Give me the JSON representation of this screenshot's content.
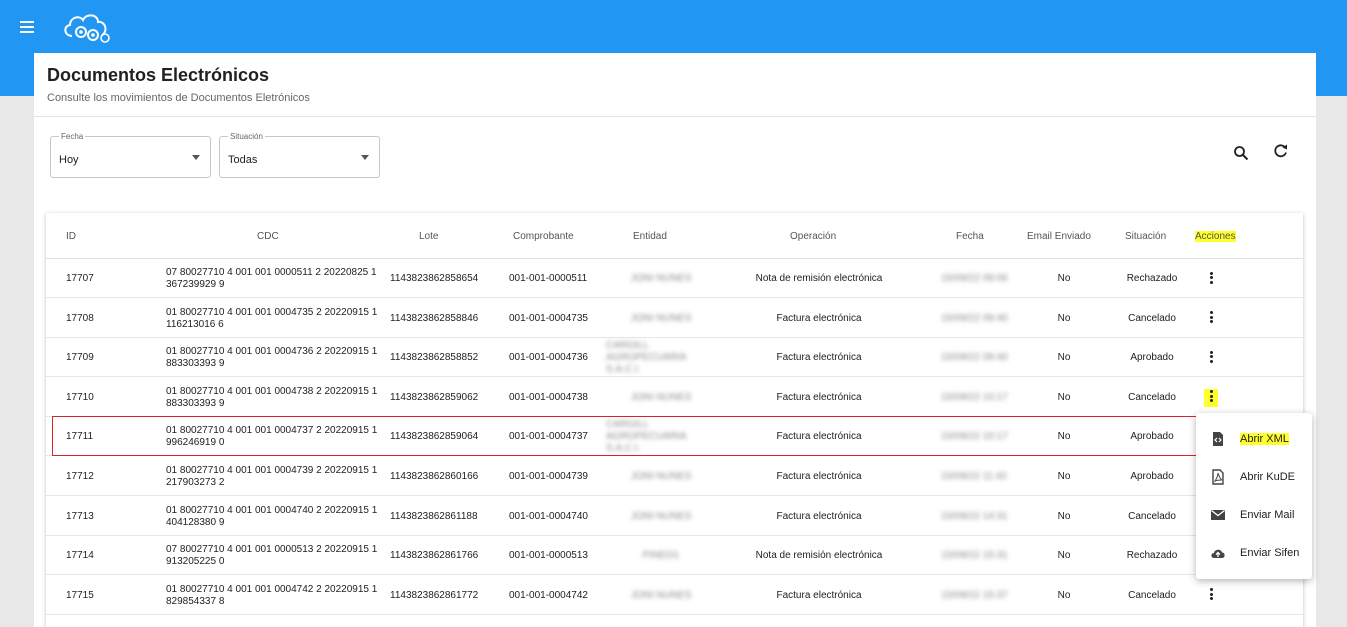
{
  "app": {
    "logo": "cloud-gears-logo"
  },
  "page": {
    "title": "Documentos Electrónicos",
    "subtitle": "Consulte los movimientos de Documentos Eletrónicos"
  },
  "filters": {
    "fecha": {
      "label": "Fecha",
      "value": "Hoy"
    },
    "situacion": {
      "label": "Situación",
      "value": "Todas"
    }
  },
  "table": {
    "headers": {
      "id": "ID",
      "cdc": "CDC",
      "lote": "Lote",
      "comprobante": "Comprobante",
      "entidad": "Entidad",
      "operacion": "Operación",
      "fecha": "Fecha",
      "email": "Email Enviado",
      "situacion": "Situación",
      "acciones": "Acciones"
    },
    "rows": [
      {
        "id": "17707",
        "cdc1": "07 80027710 4 001 001 0000511 2 20220825 1",
        "cdc2": "367239929 9",
        "lote": "1143823862858654",
        "comprobante": "001-001-0000511",
        "entidad": "JONI NUNES",
        "operacion": "Nota de remisión electrónica",
        "fecha": "15/09/22 09:06",
        "email": "No",
        "situacion": "Rechazado"
      },
      {
        "id": "17708",
        "cdc1": "01 80027710 4 001 001 0004735 2 20220915 1",
        "cdc2": "116213016 6",
        "lote": "1143823862858846",
        "comprobante": "001-001-0004735",
        "entidad": "JONI NUNES",
        "operacion": "Factura electrónica",
        "fecha": "15/09/22 09:40",
        "email": "No",
        "situacion": "Cancelado"
      },
      {
        "id": "17709",
        "cdc1": "01 80027710 4 001 001 0004736 2 20220915 1",
        "cdc2": "883303393 9",
        "lote": "1143823862858852",
        "comprobante": "001-001-0004736",
        "entidad": "CARGILL AGROPECUARIA S.A.C.I.",
        "operacion": "Factura electrónica",
        "fecha": "15/09/22 09:40",
        "email": "No",
        "situacion": "Aprobado"
      },
      {
        "id": "17710",
        "cdc1": "01 80027710 4 001 001 0004738 2 20220915 1",
        "cdc2": "883303393 9",
        "lote": "1143823862859062",
        "comprobante": "001-001-0004738",
        "entidad": "JONI NUNES",
        "operacion": "Factura electrónica",
        "fecha": "15/09/22 10:17",
        "email": "No",
        "situacion": "Cancelado"
      },
      {
        "id": "17711",
        "cdc1": "01 80027710 4 001 001 0004737 2 20220915 1",
        "cdc2": "996246919 0",
        "lote": "1143823862859064",
        "comprobante": "001-001-0004737",
        "entidad": "CARGILL AGROPECUARIA S.A.C.I.",
        "operacion": "Factura electrónica",
        "fecha": "15/09/22 10:17",
        "email": "No",
        "situacion": "Aprobado"
      },
      {
        "id": "17712",
        "cdc1": "01 80027710 4 001 001 0004739 2 20220915 1",
        "cdc2": "217903273 2",
        "lote": "1143823862860166",
        "comprobante": "001-001-0004739",
        "entidad": "JONI NUNES",
        "operacion": "Factura electrónica",
        "fecha": "15/09/22 11:42",
        "email": "No",
        "situacion": "Aprobado"
      },
      {
        "id": "17713",
        "cdc1": "01 80027710 4 001 001 0004740 2 20220915 1",
        "cdc2": "404128380 9",
        "lote": "1143823862861188",
        "comprobante": "001-001-0004740",
        "entidad": "JONI NUNES",
        "operacion": "Factura electrónica",
        "fecha": "15/09/22 14:31",
        "email": "No",
        "situacion": "Cancelado"
      },
      {
        "id": "17714",
        "cdc1": "07 80027710 4 001 001 0000513 2 20220915 1",
        "cdc2": "913205225 0",
        "lote": "1143823862861766",
        "comprobante": "001-001-0000513",
        "entidad": "PINEO1",
        "operacion": "Nota de remisión electrónica",
        "fecha": "15/09/22 15:31",
        "email": "No",
        "situacion": "Rechazado"
      },
      {
        "id": "17715",
        "cdc1": "01 80027710 4 001 001 0004742 2 20220915 1",
        "cdc2": "829854337 8",
        "lote": "1143823862861772",
        "comprobante": "001-001-0004742",
        "entidad": "JONI NUNES",
        "operacion": "Factura electrónica",
        "fecha": "15/09/22 15:37",
        "email": "No",
        "situacion": "Cancelado"
      }
    ]
  },
  "context_menu": {
    "items": [
      {
        "label": "Abrir XML",
        "icon": "xml-file-icon"
      },
      {
        "label": "Abrir KuDE",
        "icon": "pdf-icon"
      },
      {
        "label": "Enviar Mail",
        "icon": "mail-icon"
      },
      {
        "label": "Enviar Sifen",
        "icon": "cloud-upload-icon"
      }
    ]
  },
  "colors": {
    "topbar": "#2196f3",
    "highlight": "#ffff2c",
    "selection_border": "#d3252a"
  }
}
